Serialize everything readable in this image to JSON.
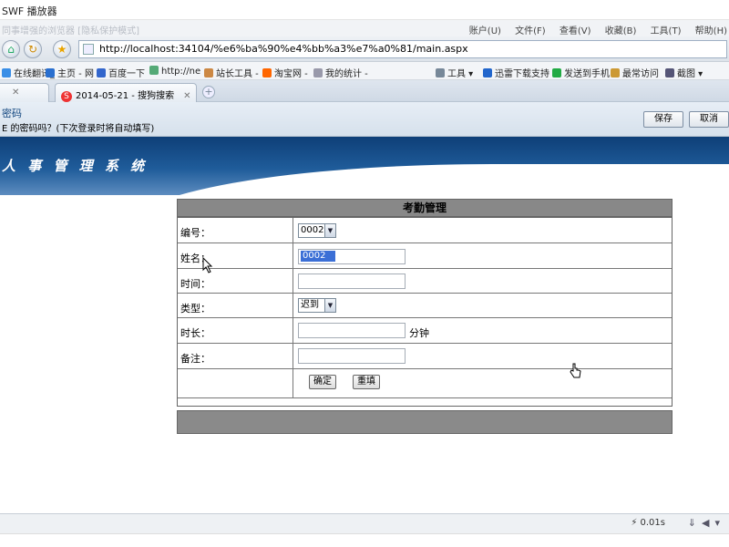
{
  "window": {
    "title": "SWF 播放器",
    "faded_line": "同事增强的浏览器  [隐私保护模式]"
  },
  "menu": [
    "账户(U)",
    "文件(F)",
    "查看(V)",
    "收藏(B)",
    "工具(T)",
    "帮助(H)"
  ],
  "address": {
    "url": "http://localhost:34104/%e6%ba%90%e4%bb%a3%e7%a0%81/main.aspx"
  },
  "favorites": [
    {
      "label": "在线翻译_",
      "color": "#3a8ee6"
    },
    {
      "label": "主页 - 网",
      "color": "#2a6fcf"
    },
    {
      "label": "百度一下",
      "color": "#3366cc"
    },
    {
      "label": "http://ne",
      "color": "#5a7"
    },
    {
      "label": "站长工具 -",
      "color": "#c84"
    },
    {
      "label": "淘宝网 -",
      "color": "#f60"
    },
    {
      "label": "我的统计 -",
      "color": "#99a"
    },
    {
      "label": "工具 ▾",
      "color": "#789"
    },
    {
      "label": "迅雷下载支持",
      "color": "#26c"
    },
    {
      "label": "发送到手机",
      "color": "#2a4"
    },
    {
      "label": "最常访问",
      "color": "#c93"
    },
    {
      "label": "截图 ▾",
      "color": "#557"
    }
  ],
  "tabs": [
    {
      "label": "",
      "closable": true
    },
    {
      "label": "2014-05-21 - 搜狗搜索",
      "closable": true
    }
  ],
  "password_bar": {
    "line1": "密码",
    "line2": "E 的密码吗？(下次登录时将自动填写)",
    "save": "保存",
    "cancel": "取消"
  },
  "banner": {
    "title": "人 事 管 理 系 统"
  },
  "form": {
    "title": "考勤管理",
    "rows": [
      {
        "label": "编号：",
        "type": "select",
        "value": "0002"
      },
      {
        "label": "姓名：",
        "type": "input",
        "value": "0002"
      },
      {
        "label": "时间：",
        "type": "input",
        "value": ""
      },
      {
        "label": "类型：",
        "type": "select",
        "value": "迟到"
      },
      {
        "label": "时长：",
        "type": "input",
        "value": "",
        "unit": "分钟"
      },
      {
        "label": "备注：",
        "type": "input",
        "value": ""
      }
    ],
    "confirm": "确定",
    "reset": "重填"
  },
  "statusbar": {
    "load_time": "0.01s"
  }
}
